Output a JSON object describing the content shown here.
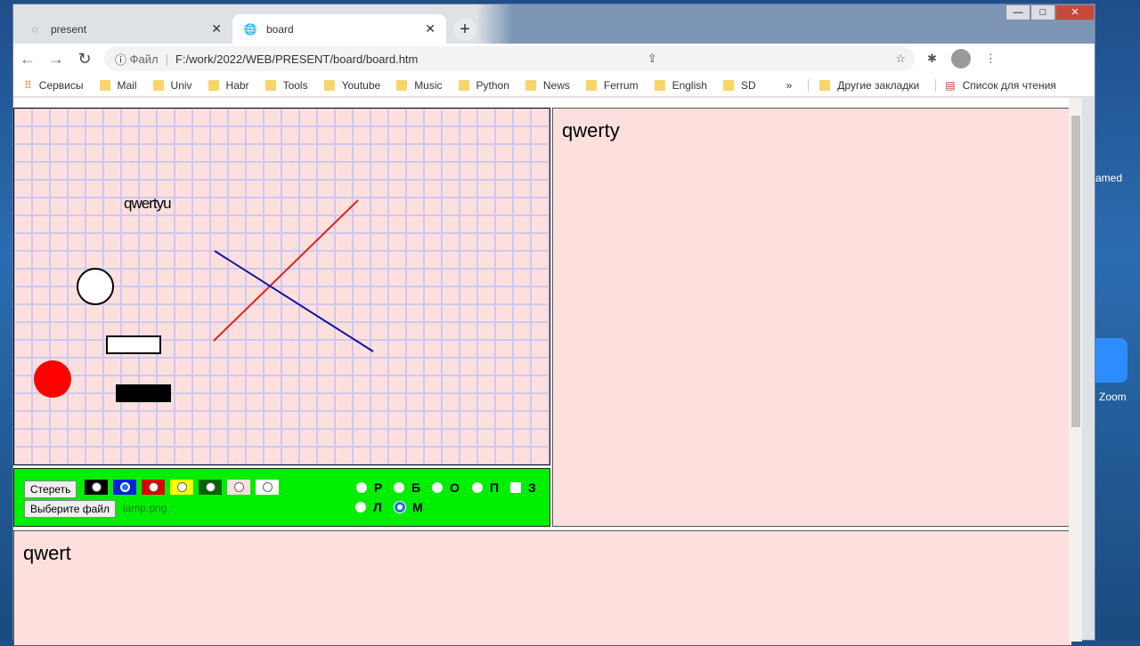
{
  "tabs": [
    {
      "title": "present",
      "icon": "loading-icon"
    },
    {
      "title": "board",
      "icon": "globe-icon"
    }
  ],
  "omnibox": {
    "scheme": "Файл",
    "url": "F:/work/2022/WEB/PRESENT/board/board.htm"
  },
  "bookmarks": {
    "apps": "Сервисы",
    "items": [
      "Mail",
      "Univ",
      "Habr",
      "Tools",
      "Youtube",
      "Music",
      "Python",
      "News",
      "Ferrum",
      "English",
      "SD"
    ],
    "overflow": "»",
    "other": "Другие закладки",
    "reading": "Список для чтения"
  },
  "canvas": {
    "text": "qwertyu"
  },
  "tools": {
    "clear": "Стереть",
    "file_button": "Выберите файл",
    "file_name": "lamp.png",
    "colors": [
      "#000000",
      "#0022dd",
      "#dd0000",
      "#ffff00",
      "#006600",
      "#fde0de",
      "#ffffff"
    ],
    "modes": [
      "Р",
      "Б",
      "О",
      "П",
      "З",
      "Л",
      "М"
    ],
    "selected_mode": "М"
  },
  "right_panel": {
    "text": "qwerty"
  },
  "bottom_panel": {
    "text": "qwert"
  },
  "desktop": {
    "user": "amed",
    "zoom": "Zoom"
  }
}
